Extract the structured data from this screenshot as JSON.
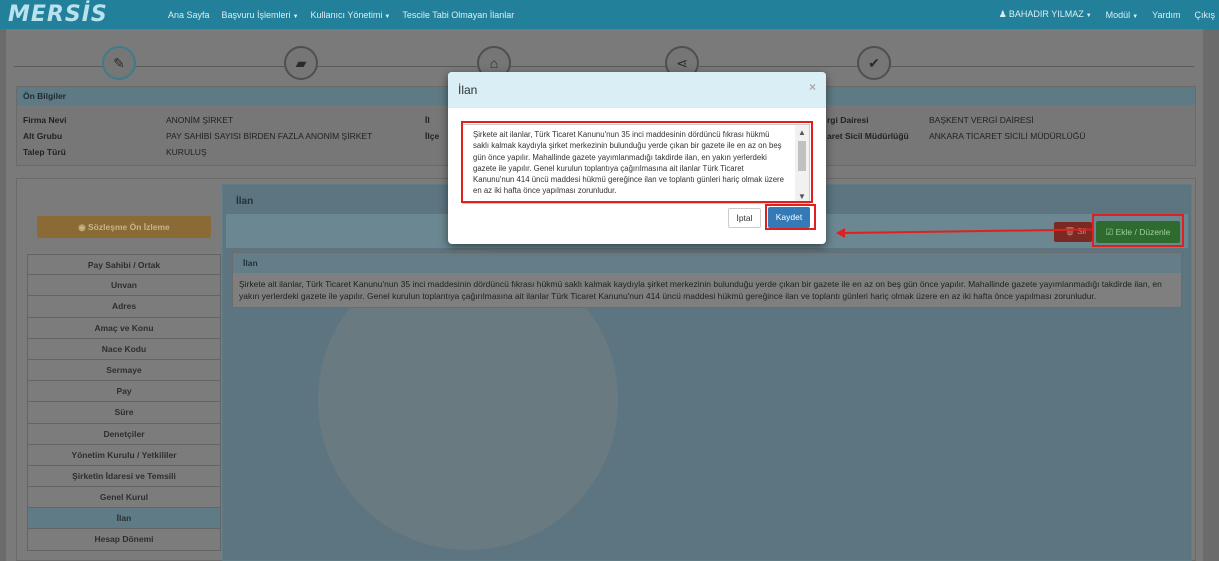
{
  "navbar": {
    "logo": "MERSİS",
    "items": [
      "Ana Sayfa",
      "Başvuru İşlemleri",
      "Kullanıcı Yönetimi",
      "Tescile Tabi Olmayan İlanlar"
    ],
    "user": "BAHADIR YILMAZ",
    "modul": "Modül",
    "yardim": "Yardım",
    "cikis": "Çıkış"
  },
  "steps": [
    "pencil-icon",
    "folder-open-icon",
    "institution-icon",
    "share-icon",
    "check-icon"
  ],
  "on_bilgiler": {
    "title": "Ön Bilgiler",
    "firma_nevi_label": "Firma Nevi",
    "firma_nevi_value": "ANONİM ŞİRKET",
    "alt_grubu_label": "Alt Grubu",
    "alt_grubu_value": "PAY SAHİBİ SAYISI BİRDEN FAZLA ANONİM ŞİRKET",
    "talep_turu_label": "Talep Türü",
    "talep_turu_value": "KURULUŞ",
    "il_label": "İl",
    "ilce_label": "İlçe",
    "vergi_dairesi_label": "rgi Dairesi",
    "vergi_dairesi_value": "BAŞKENT VERGİ DAİRESİ",
    "sicil_label": "aret Sicil Müdürlüğü",
    "sicil_value": "ANKARA TİCARET SİCİLİ MÜDÜRLÜĞÜ"
  },
  "left": {
    "preview_button": "Sözleşme Ön İzleme",
    "menu": [
      "Pay Sahibi / Ortak",
      "Unvan",
      "Adres",
      "Amaç ve Konu",
      "Nace Kodu",
      "Sermaye",
      "Pay",
      "Süre",
      "Denetçiler",
      "Yönetim Kurulu / Yetkililer",
      "Şirketin İdaresi ve Temsili",
      "Genel Kurul",
      "İlan",
      "Hesap Dönemi"
    ],
    "active_index": 12
  },
  "content": {
    "title": "İlan",
    "sil": "Sil",
    "ekle": "Ekle / Düzenle",
    "table_header": "İlan",
    "table_text": "Şirkete ait ilanlar, Türk Ticaret Kanunu'nun 35 inci maddesinin dördüncü fıkrası hükmü saklı kalmak kaydıyla şirket merkezinin bulunduğu yerde çıkan bir gazete ile en az on beş gün önce yapılır. Mahallinde gazete yayımlanmadığı takdirde ilan, en yakın yerlerdeki gazete ile yapılır. Genel kurulun toplantıya çağırılmasına ait ilanlar Türk Ticaret Kanunu'nun 414 üncü maddesi hükmü gereğince ilan ve toplantı günleri hariç olmak üzere en az iki hafta önce yapılması zorunludur."
  },
  "modal": {
    "title": "İlan",
    "close": "×",
    "text": "Şirkete ait ilanlar, Türk Ticaret Kanunu'nun 35 inci maddesinin dördüncü fıkrası hükmü saklı kalmak kaydıyla şirket merkezinin bulunduğu yerde çıkan bir gazete ile en az on beş gün önce yapılır. Mahallinde gazete yayımlanmadığı takdirde ilan, en yakın yerlerdeki gazete ile yapılır. Genel kurulun toplantıya çağırılmasına ait ilanlar Türk Ticaret Kanunu'nun 414 üncü maddesi hükmü gereğince ilan ve toplantı günleri hariç olmak üzere en az iki hafta önce yapılması zorunludur.",
    "cancel": "İptal",
    "save": "Kaydet"
  }
}
